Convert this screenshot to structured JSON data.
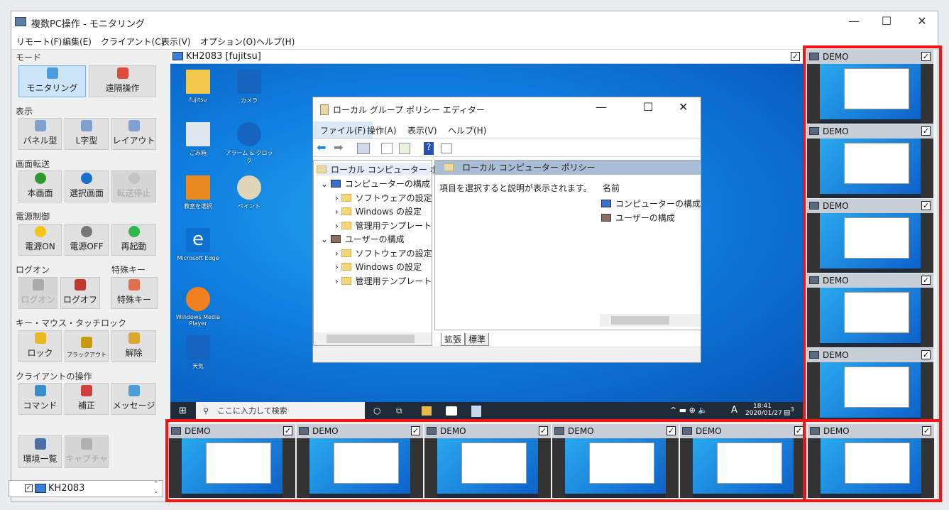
{
  "window": {
    "title": "複数PC操作 - モニタリング",
    "controls": [
      "—",
      "☐",
      "✕"
    ]
  },
  "menu": [
    "リモート(F)",
    "編集(E)",
    "クライアント(C)",
    "表示(V)",
    "オプション(O)",
    "ヘルプ(H)"
  ],
  "sidebar": {
    "groups": {
      "mode": "モード",
      "view": "表示",
      "transfer": "画面転送",
      "power": "電源制御",
      "logon": "ログオン",
      "special": "特殊キー",
      "lock": "キー・マウス・タッチロック",
      "client": "クライアントの操作"
    },
    "buttons": {
      "monitoring": "モニタリング",
      "remote": "遠隔操作",
      "panel": "パネル型",
      "lshape": "L字型",
      "layout": "レイアウト",
      "main_screen": "本画面",
      "select_screen": "選択画面",
      "stop_transfer": "転送停止",
      "power_on": "電源ON",
      "power_off": "電源OFF",
      "reboot": "再起動",
      "logon": "ログオン",
      "logoff": "ログオフ",
      "special_key": "特殊キー",
      "lock": "ロック",
      "blackout": "ブラックアウト",
      "unlock": "解除",
      "command": "コマンド",
      "correct": "補正",
      "message": "メッセージ",
      "env_list": "環境一覧",
      "capture": "キャプチャ"
    },
    "tree_item": "KH2083"
  },
  "remote": {
    "title": "KH2083 [fujitsu]",
    "checked": true,
    "desktop_icons": [
      "fujitsu",
      "カメラ",
      "ごみ箱",
      "アラーム & クロック",
      "教室を選択",
      "ペイント",
      "Microsoft Edge",
      "Windows Media Player",
      "天気"
    ],
    "taskbar": {
      "search_placeholder": "ここに入力して検索",
      "time": "18:41",
      "date": "2020/01/27",
      "ime": "A",
      "notifications": "3"
    },
    "gpedit": {
      "title": "ローカル グループ ポリシー エディター",
      "menu": [
        "ファイル(F)",
        "操作(A)",
        "表示(V)",
        "ヘルプ(H)"
      ],
      "tree": [
        "ローカル コンピューター ポリシー",
        "コンピューターの構成",
        "ソフトウェアの設定",
        "Windows の設定",
        "管理用テンプレート",
        "ユーザーの構成",
        "ソフトウェアの設定",
        "Windows の設定",
        "管理用テンプレート"
      ],
      "header": "ローカル コンピューター ポリシー",
      "description": "項目を選択すると説明が表示されます。",
      "column": "名前",
      "items": [
        "コンピューターの構成",
        "ユーザーの構成"
      ],
      "tabs": [
        "拡張",
        "標準"
      ]
    }
  },
  "thumbnails": {
    "label": "DEMO",
    "count_right": 5,
    "count_bottom": 6,
    "checked": true
  },
  "colors": {
    "highlight": "#ff1010",
    "accent": "#0078d7"
  }
}
